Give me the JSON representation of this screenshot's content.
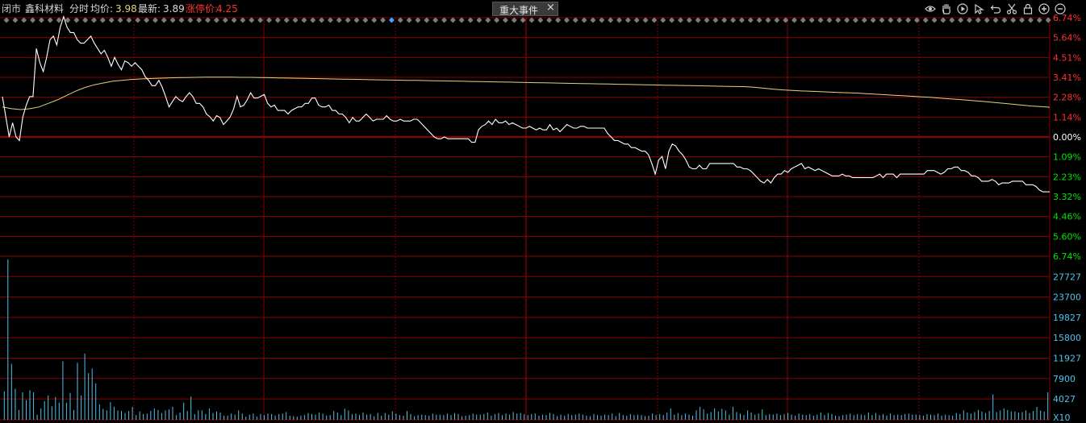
{
  "header": {
    "status": "闭市",
    "stock_name": "鑫科材料",
    "chart_mode": "分时",
    "avg_label": "均价:",
    "avg_value": "3.98",
    "latest_label": "最新:",
    "latest_value": "3.89",
    "limit_label": "涨停价:",
    "limit_value": "4.25"
  },
  "event_tab": {
    "label": "重大事件",
    "close": "×"
  },
  "toolbar_icons": [
    "eye-icon",
    "hand-icon",
    "play-icon",
    "pointer-icon",
    "undo-icon",
    "scissors-icon",
    "lock-icon",
    "zoom-in-icon",
    "zoom-out-icon"
  ],
  "colors": {
    "up": "#ff3232",
    "down": "#00e600",
    "grid": "#8b0000",
    "price_line": "#ffffff",
    "avg_line": "#e6d37a",
    "volume": "#4fc3e8",
    "neutral": "#ffffff",
    "marker": "#7c7c7c",
    "marker_active": "#3ea6ff"
  },
  "chart_data": {
    "type": "line",
    "y_axis_up_labels": [
      "6.74%",
      "5.64%",
      "4.51%",
      "3.41%",
      "2.28%",
      "1.14%"
    ],
    "y_axis_zero_label": "0.00%",
    "y_axis_down_labels": [
      "1.09%",
      "2.23%",
      "3.32%",
      "4.46%",
      "5.60%",
      "6.74%"
    ],
    "pct_range": [
      -6.74,
      6.74
    ],
    "series": [
      {
        "values": [
          2.28,
          1.14,
          0.0,
          0.8,
          0.0,
          -0.2,
          1.14,
          1.8,
          2.28,
          2.28,
          5.0,
          4.2,
          3.7,
          4.5,
          5.5,
          5.7,
          5.2,
          6.2,
          6.8,
          6.2,
          5.9,
          5.9,
          5.5,
          5.3,
          5.3,
          5.5,
          5.7,
          5.3,
          5.0,
          4.7,
          4.9,
          4.5,
          4.0,
          4.5,
          4.1,
          3.8,
          4.3,
          4.2,
          4.0,
          4.2,
          4.0,
          3.8,
          3.4,
          3.2,
          2.9,
          2.9,
          3.2,
          2.8,
          2.28,
          1.7,
          2.0,
          2.28,
          2.1,
          2.0,
          2.28,
          2.5,
          2.28,
          1.9,
          1.9,
          1.7,
          1.3,
          1.14,
          0.9,
          1.2,
          1.1,
          0.7,
          0.9,
          1.14,
          1.6,
          2.3,
          1.7,
          1.8,
          2.1,
          2.5,
          2.2,
          2.2,
          2.3,
          2.4,
          1.9,
          1.7,
          1.8,
          1.5,
          1.5,
          1.5,
          1.3,
          1.5,
          1.6,
          1.7,
          1.7,
          1.9,
          1.9,
          2.2,
          2.2,
          1.8,
          1.7,
          1.7,
          1.8,
          1.5,
          1.5,
          1.3,
          1.3,
          1.1,
          0.8,
          1.1,
          0.9,
          0.9,
          1.1,
          1.3,
          1.1,
          0.9,
          1.0,
          1.0,
          1.0,
          1.2,
          1.0,
          0.9,
          0.9,
          1.0,
          0.9,
          0.9,
          0.9,
          1.0,
          1.0,
          0.8,
          0.6,
          0.4,
          0.2,
          0.0,
          -0.1,
          -0.1,
          0.0,
          -0.1,
          -0.1,
          -0.1,
          -0.1,
          -0.1,
          -0.1,
          -0.1,
          -0.3,
          -0.3,
          0.4,
          0.6,
          0.7,
          0.9,
          0.7,
          1.0,
          0.8,
          0.8,
          0.9,
          0.7,
          0.8,
          0.7,
          0.6,
          0.5,
          0.5,
          0.6,
          0.5,
          0.4,
          0.5,
          0.4,
          0.4,
          0.7,
          0.4,
          0.5,
          0.3,
          0.5,
          0.7,
          0.6,
          0.5,
          0.5,
          0.6,
          0.6,
          0.5,
          0.5,
          0.5,
          0.5,
          0.5,
          0.5,
          0.2,
          0.0,
          -0.2,
          -0.2,
          -0.3,
          -0.4,
          -0.4,
          -0.6,
          -0.6,
          -0.7,
          -0.8,
          -0.8,
          -1.0,
          -1.5,
          -2.1,
          -1.3,
          -1.1,
          -1.8,
          -0.8,
          -0.4,
          -0.5,
          -0.8,
          -1.0,
          -1.3,
          -1.7,
          -1.8,
          -1.8,
          -1.6,
          -1.8,
          -1.8,
          -1.5,
          -1.5,
          -1.5,
          -1.5,
          -1.5,
          -1.5,
          -1.5,
          -1.5,
          -1.7,
          -1.7,
          -1.8,
          -1.8,
          -1.9,
          -2.1,
          -2.3,
          -2.5,
          -2.6,
          -2.4,
          -2.6,
          -2.3,
          -2.1,
          -2.1,
          -1.9,
          -2.0,
          -1.8,
          -1.7,
          -1.6,
          -1.5,
          -1.8,
          -1.7,
          -1.8,
          -1.9,
          -1.8,
          -1.9,
          -2.0,
          -2.1,
          -2.2,
          -2.2,
          -2.2,
          -2.1,
          -2.2,
          -2.2,
          -2.3,
          -2.3,
          -2.3,
          -2.3,
          -2.3,
          -2.3,
          -2.3,
          -2.2,
          -2.1,
          -2.3,
          -2.1,
          -2.1,
          -2.1,
          -2.3,
          -2.1,
          -2.1,
          -2.1,
          -2.1,
          -2.1,
          -2.1,
          -2.1,
          -2.1,
          -1.9,
          -1.9,
          -1.9,
          -2.0,
          -2.1,
          -2.0,
          -1.8,
          -1.8,
          -1.7,
          -1.7,
          -1.9,
          -1.9,
          -2.0,
          -2.2,
          -2.2,
          -2.3,
          -2.5,
          -2.5,
          -2.5,
          -2.4,
          -2.5,
          -2.7,
          -2.6,
          -2.6,
          -2.6,
          -2.5,
          -2.5,
          -2.5,
          -2.5,
          -2.7,
          -2.7,
          -2.7,
          -2.8,
          -3.0,
          -3.1,
          -3.1,
          -3.1
        ]
      },
      {
        "values": [
          1.7,
          1.6,
          1.55,
          1.6,
          1.7,
          1.9,
          2.1,
          2.35,
          2.6,
          2.8,
          2.95,
          3.05,
          3.15,
          3.2,
          3.25,
          3.28,
          3.3,
          3.32,
          3.34,
          3.35,
          3.36,
          3.37,
          3.38,
          3.38,
          3.38,
          3.38,
          3.37,
          3.37,
          3.36,
          3.35,
          3.34,
          3.33,
          3.32,
          3.31,
          3.3,
          3.29,
          3.28,
          3.27,
          3.26,
          3.25,
          3.24,
          3.23,
          3.22,
          3.21,
          3.2,
          3.2,
          3.19,
          3.18,
          3.17,
          3.16,
          3.15,
          3.14,
          3.13,
          3.12,
          3.11,
          3.1,
          3.09,
          3.08,
          3.07,
          3.06,
          3.05,
          3.04,
          3.03,
          3.02,
          3.01,
          3.0,
          2.99,
          2.98,
          2.97,
          2.96,
          2.95,
          2.94,
          2.93,
          2.92,
          2.91,
          2.9,
          2.89,
          2.88,
          2.87,
          2.86,
          2.85,
          2.84,
          2.8,
          2.75,
          2.7,
          2.66,
          2.63,
          2.6,
          2.58,
          2.56,
          2.54,
          2.52,
          2.5,
          2.48,
          2.45,
          2.42,
          2.39,
          2.36,
          2.33,
          2.3,
          2.27,
          2.24,
          2.2,
          2.16,
          2.12,
          2.08,
          2.04,
          2.0,
          1.95,
          1.9,
          1.85,
          1.8,
          1.75,
          1.72,
          1.68
        ]
      }
    ],
    "volume": {
      "y_axis_labels": [
        "27727",
        "23700",
        "19827",
        "15800",
        "11927",
        "7900",
        "4027"
      ],
      "unit_label": "X10",
      "range": [
        0,
        31600
      ],
      "values": [
        5500,
        31000,
        10800,
        6000,
        1900,
        5300,
        3800,
        5700,
        5300,
        1000,
        2200,
        3600,
        4700,
        2600,
        4400,
        3300,
        11300,
        3300,
        5200,
        1900,
        11000,
        4700,
        12800,
        9000,
        9900,
        7000,
        3000,
        2100,
        1800,
        3400,
        2500,
        1800,
        1700,
        1300,
        1700,
        2500,
        900,
        1600,
        1100,
        1200,
        1700,
        2200,
        1900,
        1300,
        1800,
        2000,
        2500,
        900,
        1400,
        3300,
        1700,
        4500,
        1100,
        1800,
        1800,
        1100,
        2200,
        1300,
        1600,
        1400,
        800,
        800,
        1200,
        1000,
        1800,
        1200,
        600,
        1000,
        1200,
        600,
        1100,
        900,
        1200,
        1100,
        800,
        1100,
        1200,
        1500,
        800,
        700,
        600,
        800,
        900,
        1300,
        1100,
        1000,
        1400,
        1200,
        800,
        900,
        1700,
        1400,
        900,
        2100,
        1800,
        1100,
        1200,
        900,
        1400,
        1000,
        1100,
        700,
        1300,
        800,
        1300,
        1000,
        1600,
        1200,
        900,
        800,
        1700,
        1100,
        700,
        900,
        1000,
        900,
        800,
        1200,
        1000,
        1000,
        900,
        1200,
        900,
        1300,
        1100,
        700,
        800,
        900,
        1200,
        1000,
        1000,
        1100,
        1400,
        800,
        1100,
        1300,
        900,
        1200,
        1000,
        1500,
        1200,
        1300,
        1100,
        900,
        1100,
        1200,
        800,
        1000,
        900,
        1300,
        1100,
        700,
        1000,
        800,
        1100,
        900,
        1000,
        1200,
        1000,
        800,
        700,
        1100,
        900,
        800,
        1000,
        900,
        1200,
        700,
        1300,
        900,
        800,
        1100,
        900,
        1000,
        900,
        700,
        800,
        1200,
        900,
        1100,
        900,
        1400,
        2200,
        1000,
        1300,
        900,
        1200,
        1000,
        800,
        1800,
        2500,
        2000,
        1200,
        1500,
        2200,
        1600,
        2100,
        1800,
        1000,
        2500,
        1500,
        1200,
        900,
        1800,
        1400,
        1000,
        1200,
        2000,
        900,
        1100,
        1000,
        1200,
        900,
        1100,
        1300,
        1000,
        800,
        1200,
        1000,
        900,
        1100,
        800,
        1000,
        1400,
        900,
        1300,
        1100,
        800,
        700,
        900,
        1000,
        1200,
        900,
        1100,
        1000,
        900,
        1400,
        900,
        1300,
        900,
        1100,
        800,
        1200,
        900,
        1000,
        900,
        1100,
        1200,
        1000,
        1000,
        900,
        800,
        1100,
        1000,
        900,
        1200,
        800,
        1000,
        900,
        800,
        1300,
        1100,
        1800,
        1400,
        1200,
        1500,
        1900,
        1600,
        1300,
        1700,
        4900,
        1500,
        1800,
        2200,
        1900,
        1600,
        1600,
        1400,
        1500,
        1800,
        1300,
        1700,
        2500,
        1800,
        1600,
        5300
      ]
    }
  }
}
